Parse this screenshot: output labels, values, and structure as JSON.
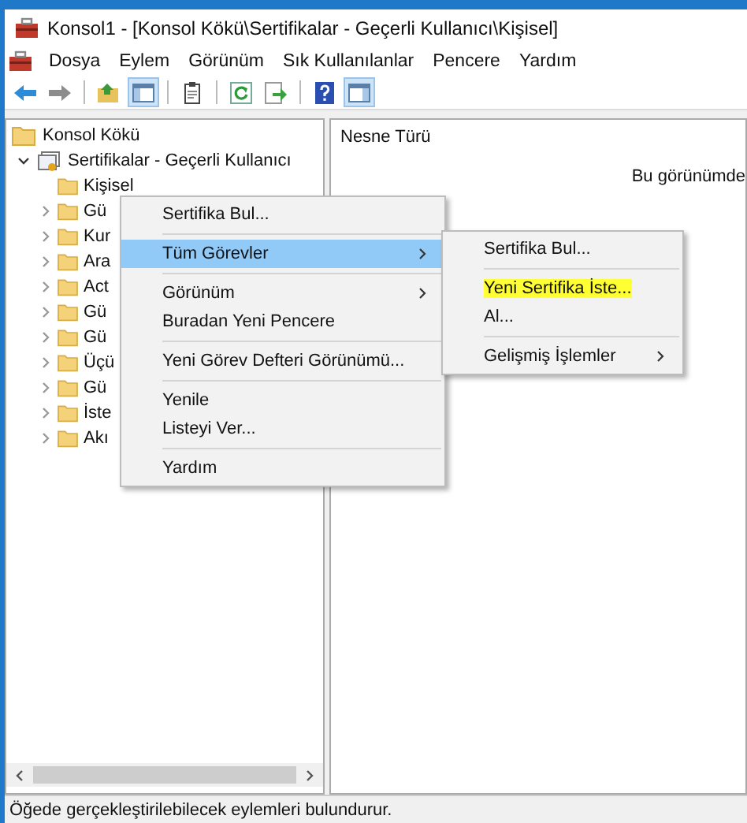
{
  "window": {
    "title": "Konsol1 - [Konsol Kökü\\Sertifikalar - Geçerli Kullanıcı\\Kişisel]"
  },
  "menu_bar": [
    "Dosya",
    "Eylem",
    "Görünüm",
    "Sık Kullanılanlar",
    "Pencere",
    "Yardım"
  ],
  "toolbar": [
    {
      "kind": "back",
      "pressed": false
    },
    {
      "kind": "forward",
      "pressed": false
    },
    {
      "kind": "separator"
    },
    {
      "kind": "up",
      "pressed": false
    },
    {
      "kind": "tree",
      "pressed": true
    },
    {
      "kind": "separator"
    },
    {
      "kind": "clipboard",
      "pressed": false
    },
    {
      "kind": "separator"
    },
    {
      "kind": "refresh",
      "pressed": false
    },
    {
      "kind": "export",
      "pressed": false
    },
    {
      "kind": "separator"
    },
    {
      "kind": "help",
      "pressed": false
    },
    {
      "kind": "action-pane",
      "pressed": true
    }
  ],
  "tree": [
    {
      "label": "Konsol Kökü",
      "kind": "folder",
      "children": [
        {
          "label": "Sertifikalar - Geçerli Kullanıcı",
          "kind": "store",
          "expanded": true,
          "children": [
            {
              "label": "Kişisel",
              "expandable": false
            },
            {
              "label": "Gü",
              "expandable": true
            },
            {
              "label": "Kur",
              "expandable": true
            },
            {
              "label": "Ara",
              "expandable": true
            },
            {
              "label": "Act",
              "expandable": true
            },
            {
              "label": "Gü",
              "expandable": true
            },
            {
              "label": "Gü",
              "expandable": true
            },
            {
              "label": "Üçü",
              "expandable": true
            },
            {
              "label": "Gü",
              "expandable": true
            },
            {
              "label": "İste",
              "expandable": true
            },
            {
              "label": "Akı",
              "expandable": true
            }
          ]
        }
      ]
    }
  ],
  "result_pane": {
    "column_header": "Nesne Türü",
    "message": "Bu görünümde"
  },
  "context_menu": [
    {
      "kind": "item",
      "label": "Sertifika Bul...",
      "selected": false,
      "has_submenu": false
    },
    {
      "kind": "separator"
    },
    {
      "kind": "item",
      "label": "Tüm Görevler",
      "selected": true,
      "has_submenu": true
    },
    {
      "kind": "separator"
    },
    {
      "kind": "item",
      "label": "Görünüm",
      "selected": false,
      "has_submenu": true
    },
    {
      "kind": "item",
      "label": "Buradan Yeni Pencere",
      "selected": false,
      "has_submenu": false
    },
    {
      "kind": "separator"
    },
    {
      "kind": "item",
      "label": "Yeni Görev Defteri Görünümü...",
      "selected": false,
      "has_submenu": false
    },
    {
      "kind": "separator"
    },
    {
      "kind": "item",
      "label": "Yenile",
      "selected": false,
      "has_submenu": false
    },
    {
      "kind": "item",
      "label": "Listeyi Ver...",
      "selected": false,
      "has_submenu": false
    },
    {
      "kind": "separator"
    },
    {
      "kind": "item",
      "label": "Yardım",
      "selected": false,
      "has_submenu": false
    }
  ],
  "submenu": [
    {
      "kind": "item",
      "label": "Sertifika Bul...",
      "highlighted": false,
      "has_submenu": false
    },
    {
      "kind": "separator"
    },
    {
      "kind": "item",
      "label": "Yeni Sertifika İste...",
      "highlighted": true,
      "has_submenu": false
    },
    {
      "kind": "item",
      "label": "Al...",
      "highlighted": false,
      "has_submenu": false
    },
    {
      "kind": "separator"
    },
    {
      "kind": "item",
      "label": "Gelişmiş İşlemler",
      "highlighted": false,
      "has_submenu": true
    }
  ],
  "status_bar": "Öğede gerçekleştirilebilecek eylemleri bulundurur."
}
